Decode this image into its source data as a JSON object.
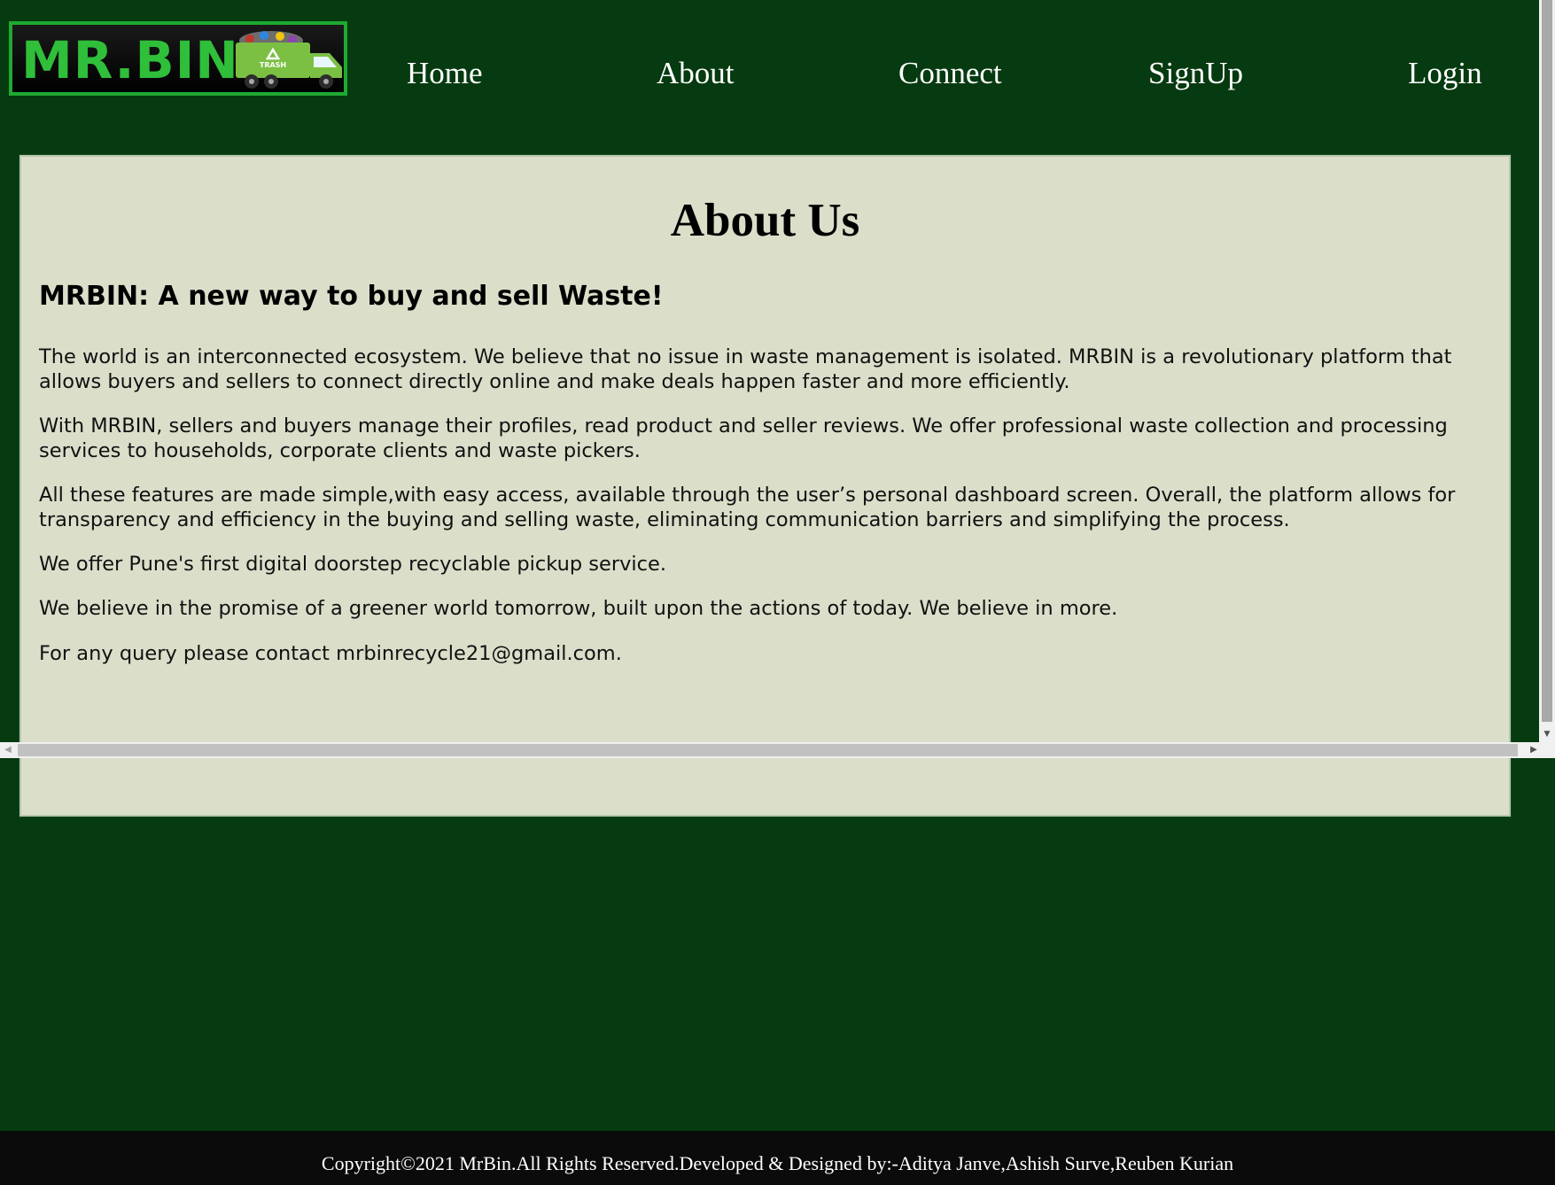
{
  "header": {
    "logo_text": "MR.BIN",
    "logo_badge": "TRASH",
    "nav": [
      {
        "label": "Home"
      },
      {
        "label": "About"
      },
      {
        "label": "Connect"
      },
      {
        "label": "SignUp"
      },
      {
        "label": "Login"
      }
    ]
  },
  "main": {
    "title": "About Us",
    "subtitle": "MRBIN: A new way to buy and sell Waste!",
    "paragraphs": [
      "The world is an interconnected ecosystem. We believe that no issue in waste management is isolated. MRBIN is a revolutionary platform that allows buyers and sellers to connect directly online and make deals happen faster and more efficiently.",
      "With MRBIN, sellers and buyers manage their profiles, read product and seller reviews. We offer professional waste collection and processing services to households, corporate clients and waste pickers.",
      "All these features are made simple,with easy access, available through the user’s personal dashboard screen. Overall, the platform allows for transparency and efficiency in the buying and selling waste, eliminating communication barriers and simplifying the process.",
      "We offer Pune's first digital doorstep recyclable pickup service.",
      "We believe in the promise of a greener world tomorrow, built upon the actions of today. We believe in more.",
      "For any query please contact mrbinrecycle21@gmail.com."
    ]
  },
  "footer": {
    "text": "Copyright©2021 MrBin.All Rights Reserved.Developed & Designed by:-Aditya Janve,Ashish Surve,Reuben Kurian"
  },
  "colors": {
    "page_bg": "#063a10",
    "panel_bg": "#dbdfca",
    "logo_green": "#2fbf3a",
    "footer_bg": "#0b0b0b"
  },
  "icons": {
    "logo_truck": "garbage-truck-icon",
    "recycle": "recycle-icon"
  }
}
